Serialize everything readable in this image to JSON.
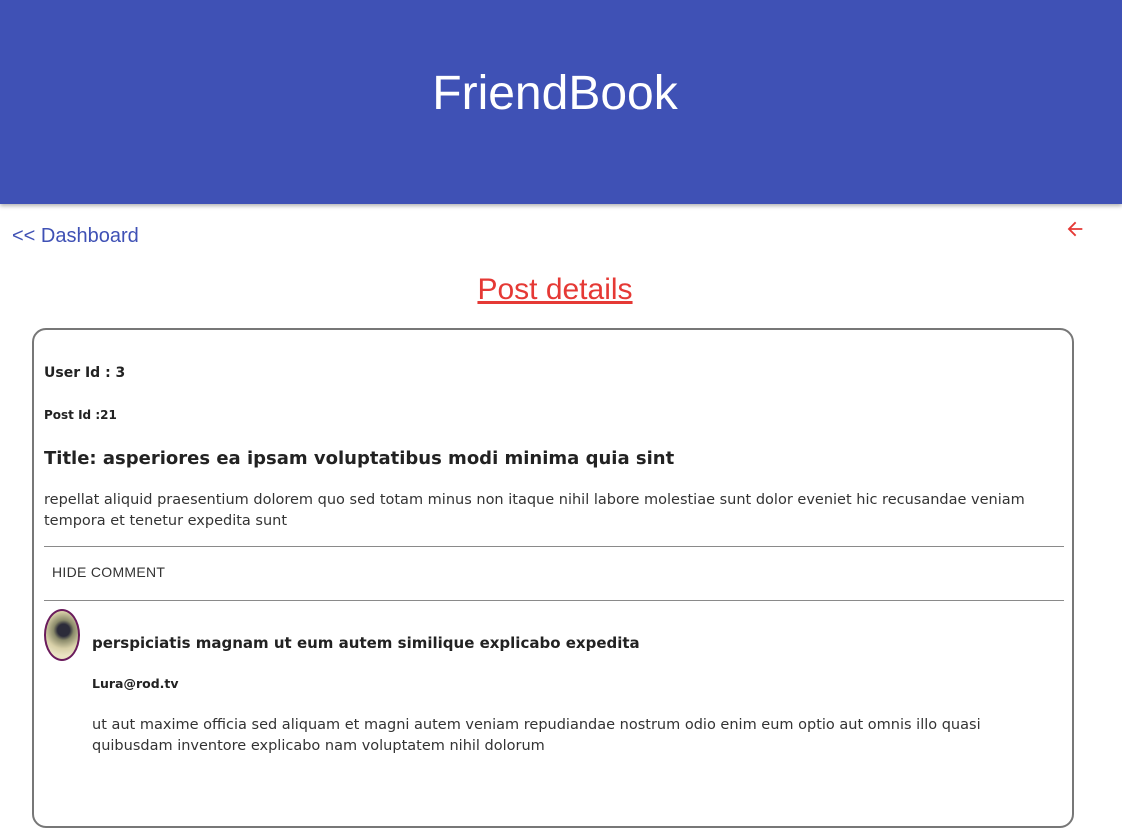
{
  "header": {
    "title": "FriendBook"
  },
  "nav": {
    "dashboard_link": "<< Dashboard",
    "back_icon": "arrow-left-icon"
  },
  "page": {
    "heading": "Post details"
  },
  "post": {
    "user_id": "User Id : 3",
    "post_id": "Post Id :21",
    "title": "Title: asperiores ea ipsam voluptatibus modi minima quia sint",
    "body": "repellat aliquid praesentium dolorem quo sed totam minus non itaque nihil labore molestiae sunt dolor eveniet hic recusandae veniam tempora et tenetur expedita sunt"
  },
  "comments_toggle": {
    "label": "HIDE COMMENT"
  },
  "comments": [
    {
      "title": "perspiciatis magnam ut eum autem similique explicabo expedita",
      "email": "Lura@rod.tv",
      "body": "ut aut maxime officia sed aliquam et magni autem veniam repudiandae nostrum odio enim eum optio aut omnis illo quasi quibusdam inventore explicabo nam voluptatem nihil dolorum"
    }
  ],
  "colors": {
    "primary": "#3f51b5",
    "accent": "#e53935",
    "avatar_border": "#6a1b5c"
  }
}
